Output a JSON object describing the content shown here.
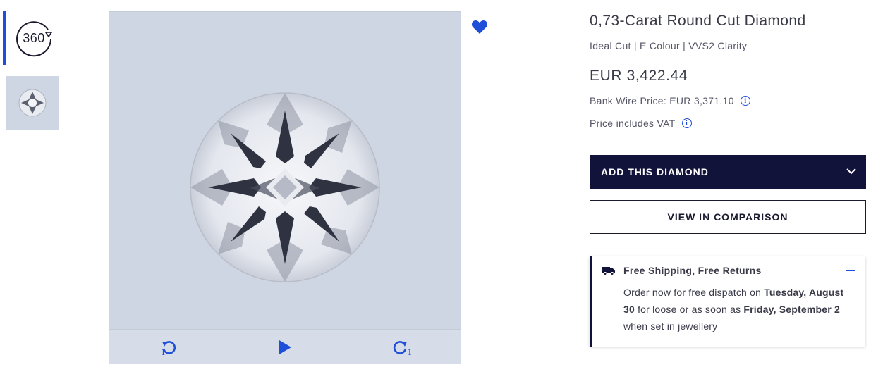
{
  "thumbnails": {
    "spin_label": "360"
  },
  "product": {
    "title": "0,73-Carat Round Cut Diamond",
    "subtitle": "Ideal Cut | E Colour | VVS2 Clarity",
    "price": "EUR 3,422.44",
    "bank_wire": "Bank Wire Price: EUR 3,371.10",
    "vat_note": "Price includes VAT"
  },
  "viewer": {
    "rotate_left_step": "1",
    "rotate_right_step": "1"
  },
  "actions": {
    "add_label": "ADD THIS DIAMOND",
    "compare_label": "VIEW IN COMPARISON"
  },
  "shipping": {
    "title": "Free Shipping, Free Returns",
    "text_1": "Order now for free dispatch on ",
    "date_1": "Tuesday, August 30",
    "text_2": " for loose or as soon as ",
    "date_2": "Friday, September 2",
    "text_3": " when set in jewellery"
  },
  "colors": {
    "accent": "#1f4ed8",
    "navy": "#12133a",
    "image_bg": "#cdd6e2"
  }
}
